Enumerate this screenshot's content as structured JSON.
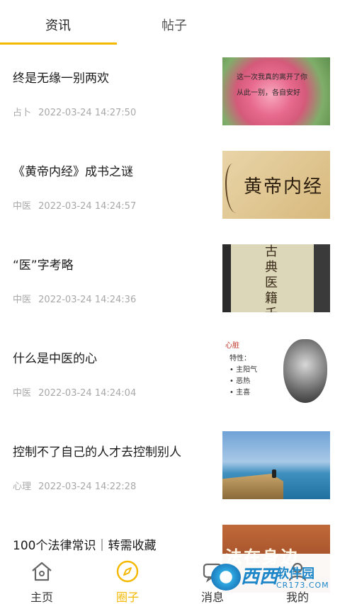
{
  "tabs": {
    "active": "资讯",
    "inactive": "帖子"
  },
  "feed": [
    {
      "title": "终是无缘一别两欢",
      "category": "占卜",
      "time": "2022-03-24 14:27:50",
      "thumb_text": [
        "这一次我真的离开了你",
        "从此一别，各自安好"
      ]
    },
    {
      "title": "《黄帝内经》成书之谜",
      "category": "中医",
      "time": "2022-03-24 14:24:57",
      "thumb_text": [
        "黄帝内经"
      ]
    },
    {
      "title": "“医”字考略",
      "category": "中医",
      "time": "2022-03-24 14:24:36",
      "thumb_text": [
        "古典医籍千字"
      ]
    },
    {
      "title": "什么是中医的心",
      "category": "中医",
      "time": "2022-03-24 14:24:04",
      "thumb_text": [
        "心脏",
        "特性：",
        "• 主阳气",
        "• 恶热",
        "• 主喜"
      ]
    },
    {
      "title": "控制不了自己的人才去控制别人",
      "category": "心理",
      "time": "2022-03-24 14:22:28",
      "thumb_text": []
    },
    {
      "title": "100个法律常识｜转需收藏",
      "category": "",
      "time": "",
      "thumb_text": [
        "法在身边"
      ]
    }
  ],
  "nav": {
    "home": "主页",
    "circle": "圈子",
    "messages": "消息",
    "me": "我的"
  },
  "watermark": {
    "brand": "西西",
    "name": "软件园",
    "domain": "CR173.COM"
  },
  "colors": {
    "accent": "#f5b800",
    "meta_text": "#a8a8a8"
  }
}
